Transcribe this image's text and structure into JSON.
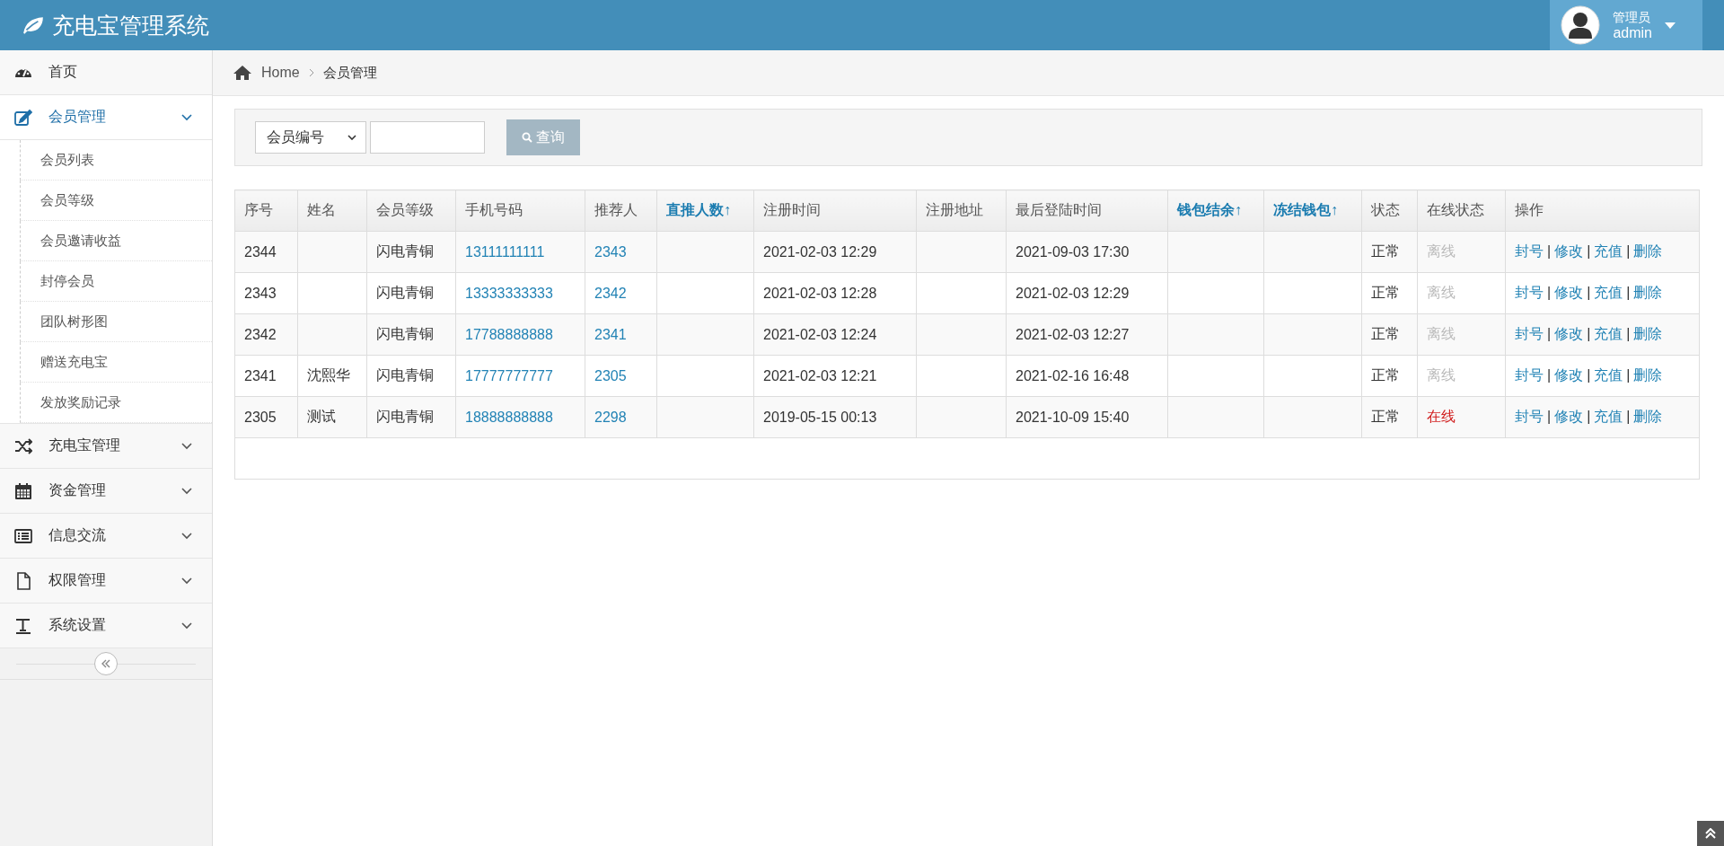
{
  "header": {
    "title": "充电宝管理系统",
    "user": {
      "role": "管理员",
      "name": "admin"
    }
  },
  "sidebar": {
    "items": [
      {
        "label": "首页"
      },
      {
        "label": "会员管理",
        "expanded": true,
        "children": [
          {
            "label": "会员列表"
          },
          {
            "label": "会员等级"
          },
          {
            "label": "会员邀请收益"
          },
          {
            "label": "封停会员"
          },
          {
            "label": "团队树形图"
          },
          {
            "label": "赠送充电宝"
          },
          {
            "label": "发放奖励记录"
          }
        ]
      },
      {
        "label": "充电宝管理",
        "expanded": false
      },
      {
        "label": "资金管理",
        "expanded": false
      },
      {
        "label": "信息交流",
        "expanded": false
      },
      {
        "label": "权限管理",
        "expanded": false
      },
      {
        "label": "系统设置",
        "expanded": false
      }
    ]
  },
  "breadcrumb": [
    "Home",
    "会员管理"
  ],
  "search": {
    "field": "会员编号",
    "button": "查询"
  },
  "table": {
    "columns": [
      {
        "label": "序号",
        "sortable": false
      },
      {
        "label": "姓名",
        "sortable": false
      },
      {
        "label": "会员等级",
        "sortable": false
      },
      {
        "label": "手机号码",
        "sortable": false
      },
      {
        "label": "推荐人",
        "sortable": false
      },
      {
        "label": "直推人数↑",
        "sortable": true
      },
      {
        "label": "注册时间",
        "sortable": false
      },
      {
        "label": "注册地址",
        "sortable": false
      },
      {
        "label": "最后登陆时间",
        "sortable": false
      },
      {
        "label": "钱包结余↑",
        "sortable": true
      },
      {
        "label": "冻结钱包↑",
        "sortable": true
      },
      {
        "label": "状态",
        "sortable": false
      },
      {
        "label": "在线状态",
        "sortable": false
      },
      {
        "label": "操作",
        "sortable": false
      }
    ],
    "separator": "|",
    "rows": [
      {
        "id": "2344",
        "name": "",
        "level": "闪电青铜",
        "phone": "13111111111",
        "referrer": "2343",
        "reg_time": "2021-02-03 12:29",
        "last_login": "2021-09-03 17:30",
        "status": "正常",
        "online_text": "离线",
        "online": false,
        "actions": [
          "封号",
          "修改",
          "充值",
          "删除"
        ]
      },
      {
        "id": "2343",
        "name": "",
        "level": "闪电青铜",
        "phone": "13333333333",
        "referrer": "2342",
        "reg_time": "2021-02-03 12:28",
        "last_login": "2021-02-03 12:29",
        "status": "正常",
        "online_text": "离线",
        "online": false,
        "actions": [
          "封号",
          "修改",
          "充值",
          "删除"
        ]
      },
      {
        "id": "2342",
        "name": "",
        "level": "闪电青铜",
        "phone": "17788888888",
        "referrer": "2341",
        "reg_time": "2021-02-03 12:24",
        "last_login": "2021-02-03 12:27",
        "status": "正常",
        "online_text": "离线",
        "online": false,
        "actions": [
          "封号",
          "修改",
          "充值",
          "删除"
        ]
      },
      {
        "id": "2341",
        "name": "沈熙华",
        "level": "闪电青铜",
        "phone": "17777777777",
        "referrer": "2305",
        "reg_time": "2021-02-03 12:21",
        "last_login": "2021-02-16 16:48",
        "status": "正常",
        "online_text": "离线",
        "online": false,
        "actions": [
          "封号",
          "修改",
          "充值",
          "删除"
        ]
      },
      {
        "id": "2305",
        "name": "测试",
        "level": "闪电青铜",
        "phone": "18888888888",
        "referrer": "2298",
        "reg_time": "2019-05-15 00:13",
        "last_login": "2021-10-09 15:40",
        "status": "正常",
        "online_text": "在线",
        "online": true,
        "actions": [
          "封号",
          "修改",
          "充值",
          "删除"
        ]
      }
    ]
  }
}
